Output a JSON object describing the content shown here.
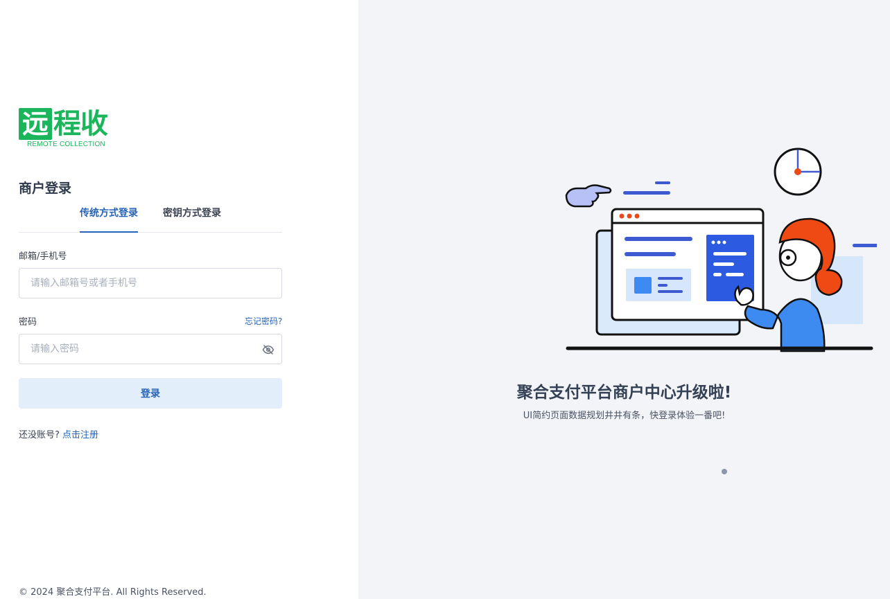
{
  "logo": {
    "main_char": "远",
    "rest": "程收",
    "subtitle": "REMOTE COLLECTION",
    "color": "#1bb55c"
  },
  "login": {
    "title": "商户登录",
    "tabs": [
      {
        "label": "传统方式登录",
        "active": true
      },
      {
        "label": "密钥方式登录",
        "active": false
      }
    ],
    "email_label": "邮箱/手机号",
    "email_placeholder": "请输入邮箱号或者手机号",
    "email_value": "",
    "password_label": "密码",
    "forgot_link": "忘记密码?",
    "password_placeholder": "请输入密码",
    "password_value": "",
    "submit_label": "登录",
    "register_prompt": "还没账号?",
    "register_link": "点击注册"
  },
  "footer": {
    "copyright": "© 2024 聚合支付平台. All Rights Reserved."
  },
  "promo": {
    "title": "聚合支付平台商户中心升级啦!",
    "subtitle": "UI简约页面数据规划井井有条，快登录体验一番吧!",
    "carousel_dots": 1,
    "active_dot": 1
  },
  "colors": {
    "accent": "#2563b8",
    "brand_green": "#1bb55c",
    "right_bg": "#f3f4f8",
    "button_bg": "#e3eefb"
  }
}
